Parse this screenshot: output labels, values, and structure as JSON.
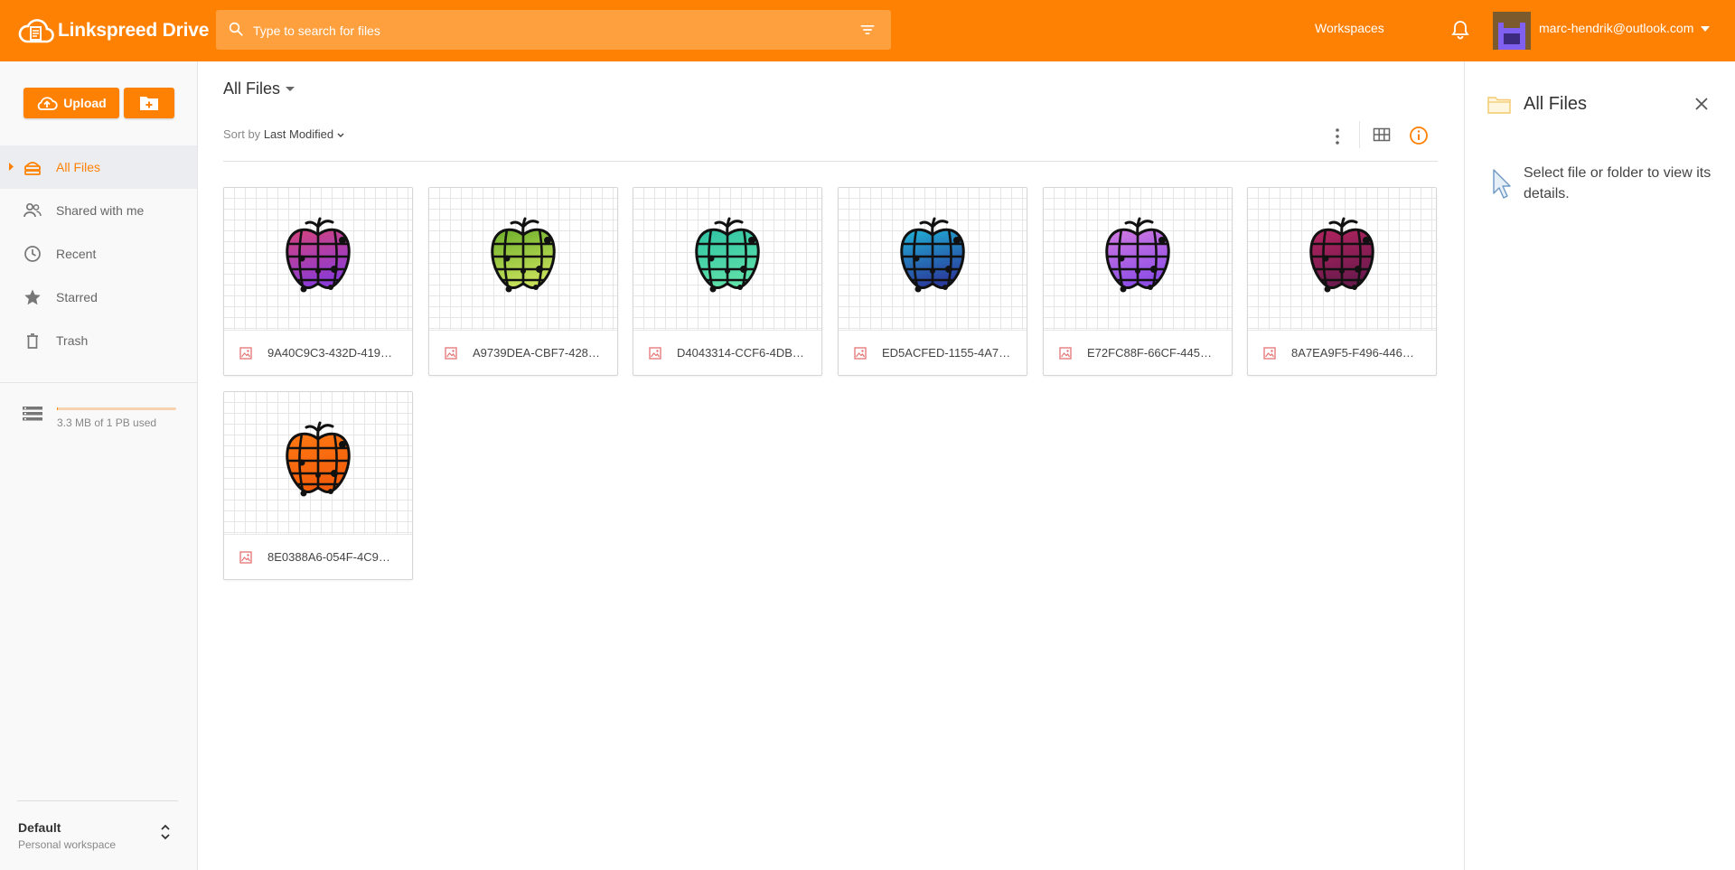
{
  "app": {
    "brand": "Linkspreed Drive",
    "colors": {
      "accent": "#ff8103",
      "sidebar_bg": "#f9f9f9",
      "active_bg": "#ecedf1"
    }
  },
  "header": {
    "search_placeholder": "Type to search for files",
    "workspaces_label": "Workspaces",
    "user_email": "marc-hendrik@outlook.com"
  },
  "sidebar": {
    "upload_label": "Upload",
    "nav": [
      {
        "label": "All Files",
        "icon": "drive-icon",
        "active": true
      },
      {
        "label": "Shared with me",
        "icon": "people-icon"
      },
      {
        "label": "Recent",
        "icon": "clock-icon"
      },
      {
        "label": "Starred",
        "icon": "star-icon"
      },
      {
        "label": "Trash",
        "icon": "trash-icon"
      }
    ],
    "storage": {
      "text": "3.3 MB of 1 PB used",
      "used_fraction": 0.005
    },
    "workspace": {
      "name": "Default",
      "type": "Personal workspace"
    }
  },
  "main": {
    "title": "All Files",
    "sort_prefix": "Sort by",
    "sort_value": "Last Modified",
    "files": [
      {
        "name": "9A40C9C3-432D-419…",
        "colors": [
          "#d6437a",
          "#8b3ad6"
        ]
      },
      {
        "name": "A9739DEA-CBF7-428…",
        "colors": [
          "#6cae2a",
          "#c6e05a"
        ]
      },
      {
        "name": "D4043314-CCF6-4DB…",
        "colors": [
          "#2ec3a5",
          "#5ee0a8"
        ]
      },
      {
        "name": "ED5ACFED-1155-4A7…",
        "colors": [
          "#20b3d6",
          "#2a3d9e"
        ]
      },
      {
        "name": "E72FC88F-66CF-445…",
        "colors": [
          "#d27ae0",
          "#8e4ee6"
        ]
      },
      {
        "name": "8A7EA9F5-F496-446…",
        "colors": [
          "#b5245f",
          "#6b1a4e"
        ]
      },
      {
        "name": "8E0388A6-054F-4C9…",
        "colors": [
          "#ff7a14",
          "#f25c0a"
        ]
      }
    ]
  },
  "details_panel": {
    "title": "All Files",
    "hint": "Select file or folder to view its details."
  }
}
